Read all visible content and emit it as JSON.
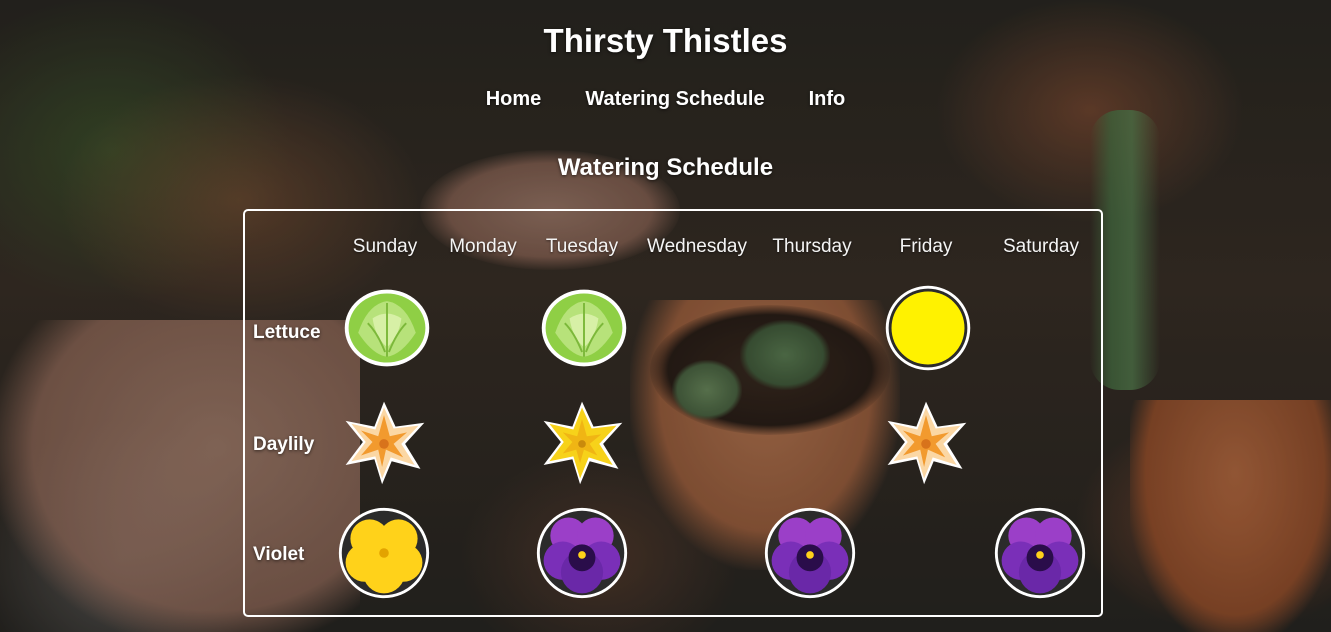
{
  "site": {
    "title": "Thirsty Thistles"
  },
  "nav": {
    "items": [
      "Home",
      "Watering Schedule",
      "Info"
    ]
  },
  "schedule": {
    "title": "Watering Schedule",
    "days": [
      "Sunday",
      "Monday",
      "Tuesday",
      "Wednesday",
      "Thursday",
      "Friday",
      "Saturday"
    ],
    "plants": [
      {
        "label": "Lettuce",
        "icons": [
          "lettuce-icon",
          "",
          "lettuce-icon",
          "",
          "",
          "yellow-circle-icon",
          ""
        ]
      },
      {
        "label": "Daylily",
        "icons": [
          "orange-daylily-icon",
          "",
          "yellow-daylily-icon",
          "",
          "",
          "orange-daylily-icon",
          ""
        ]
      },
      {
        "label": "Violet",
        "icons": [
          "yellow-pansy-icon",
          "",
          "purple-pansy-icon",
          "",
          "purple-pansy-icon",
          "",
          "purple-pansy-icon"
        ]
      }
    ]
  },
  "colors": {
    "text": "#ffffff",
    "panel_border": "#ffffff",
    "lettuce_green": "#9fd65a",
    "marker_yellow": "#fff200",
    "daylily_orange": "#f29a2e",
    "daylily_yellow": "#f7d21a",
    "pansy_yellow": "#ffd21a",
    "pansy_purple": "#7a2fb8"
  }
}
